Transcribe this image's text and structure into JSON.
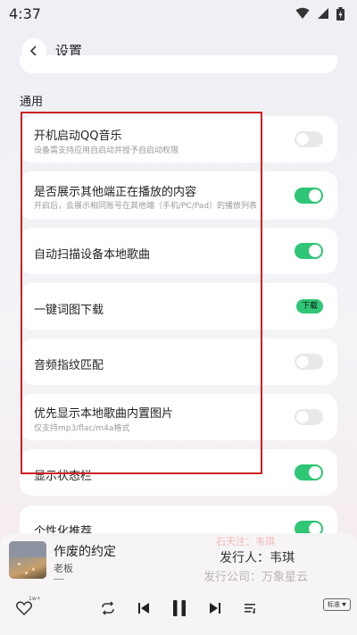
{
  "status_bar": {
    "time": "4:37"
  },
  "header": {
    "title": "设置"
  },
  "section": {
    "title": "通用"
  },
  "settings": [
    {
      "title": "开机启动QQ音乐",
      "subtitle": "设备需支持应用自启动并授予自启动权限",
      "control": "toggle",
      "on": false
    },
    {
      "title": "是否展示其他端正在播放的内容",
      "subtitle": "开启后，会展示相同账号在其他端（手机/PC/Pad）的播放列表",
      "control": "toggle",
      "on": true
    },
    {
      "title": "自动扫描设备本地歌曲",
      "control": "toggle",
      "on": true
    },
    {
      "title": "一键词图下载",
      "control": "button",
      "button_label": "下载"
    },
    {
      "title": "音频指纹匹配",
      "control": "toggle",
      "on": false
    },
    {
      "title": "优先显示本地歌曲内置图片",
      "subtitle": "仅支持mp3/flac/m4a格式",
      "control": "toggle",
      "on": false
    },
    {
      "title": "显示状态栏",
      "control": "toggle",
      "on": true
    },
    {
      "title": "个性化推荐",
      "control": "toggle",
      "on": true
    }
  ],
  "player": {
    "song_title": "作废的约定",
    "artist": "老板",
    "lyric_line_top": "石天注：韦琪",
    "lyric_line_main": "发行人：韦琪",
    "lyric_line_next": "发行公司：万象星云",
    "like_badge": "1w+",
    "quality_label": "标准"
  },
  "colors": {
    "accent": "#2fc675",
    "highlight_box": "#d01f1f"
  }
}
